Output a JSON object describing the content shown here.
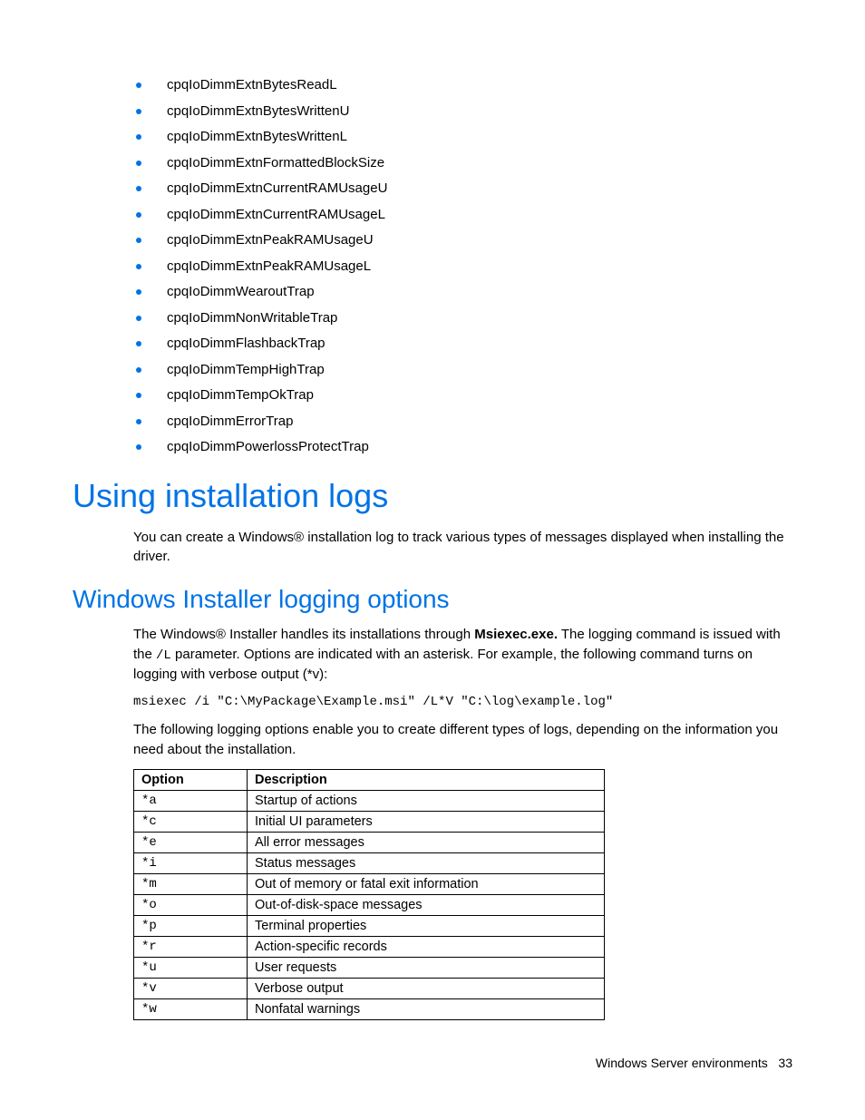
{
  "bullet_items": [
    "cpqIoDimmExtnBytesReadL",
    "cpqIoDimmExtnBytesWrittenU",
    "cpqIoDimmExtnBytesWrittenL",
    "cpqIoDimmExtnFormattedBlockSize",
    "cpqIoDimmExtnCurrentRAMUsageU",
    "cpqIoDimmExtnCurrentRAMUsageL",
    "cpqIoDimmExtnPeakRAMUsageU",
    "cpqIoDimmExtnPeakRAMUsageL",
    "cpqIoDimmWearoutTrap",
    "cpqIoDimmNonWritableTrap",
    "cpqIoDimmFlashbackTrap",
    "cpqIoDimmTempHighTrap",
    "cpqIoDimmTempOkTrap",
    "cpqIoDimmErrorTrap",
    "cpqIoDimmPowerlossProtectTrap"
  ],
  "heading1": "Using installation logs",
  "intro_para": "You can create a Windows® installation log to track various types of messages displayed when installing the driver.",
  "heading2": "Windows Installer logging options",
  "para2_prefix": "The Windows® Installer handles its installations through ",
  "para2_bold": "Msiexec.exe.",
  "para2_mid": " The logging command is issued with the ",
  "para2_code": "/L",
  "para2_suffix": " parameter. Options are indicated with an asterisk. For example, the following command turns on logging with verbose output (*v):",
  "code_block": "msiexec /i \"C:\\MyPackage\\Example.msi\" /L*V \"C:\\log\\example.log\"",
  "para3": "The following logging options enable you to create different types of logs, depending on the information you need about the installation.",
  "table": {
    "headers": [
      "Option",
      "Description"
    ],
    "rows": [
      [
        "*a",
        "Startup of actions"
      ],
      [
        "*c",
        "Initial UI parameters"
      ],
      [
        "*e",
        "All error messages"
      ],
      [
        "*i",
        "Status messages"
      ],
      [
        "*m",
        "Out of memory or fatal exit information"
      ],
      [
        "*o",
        "Out-of-disk-space messages"
      ],
      [
        "*p",
        "Terminal properties"
      ],
      [
        "*r",
        "Action-specific records"
      ],
      [
        "*u",
        "User requests"
      ],
      [
        "*v",
        "Verbose output"
      ],
      [
        "*w",
        "Nonfatal warnings"
      ]
    ]
  },
  "footer_text": "Windows Server environments",
  "footer_page": "33"
}
